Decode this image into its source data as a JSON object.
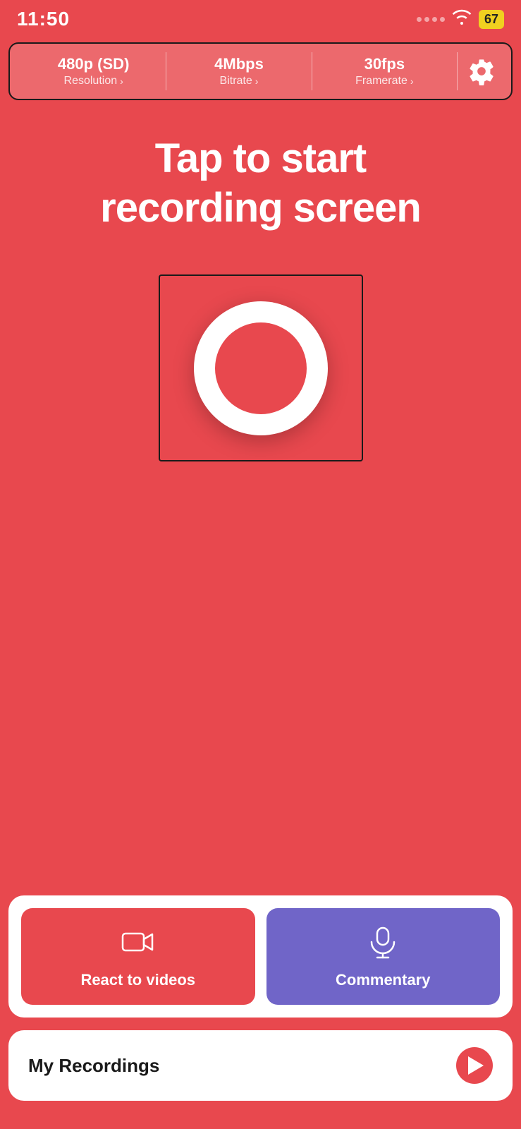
{
  "statusBar": {
    "time": "11:50",
    "battery": "67"
  },
  "settingsBar": {
    "resolution": {
      "value": "480p (SD)",
      "label": "Resolution"
    },
    "bitrate": {
      "value": "4Mbps",
      "label": "Bitrate"
    },
    "framerate": {
      "value": "30fps",
      "label": "Framerate"
    }
  },
  "mainTitle": {
    "line1": "Tap to start",
    "line2": "recording screen"
  },
  "actionButtons": {
    "reactVideos": {
      "label": "React to videos",
      "icon": "video-camera-icon"
    },
    "commentary": {
      "label": "Commentary",
      "icon": "microphone-icon"
    }
  },
  "myRecordings": {
    "label": "My Recordings"
  }
}
